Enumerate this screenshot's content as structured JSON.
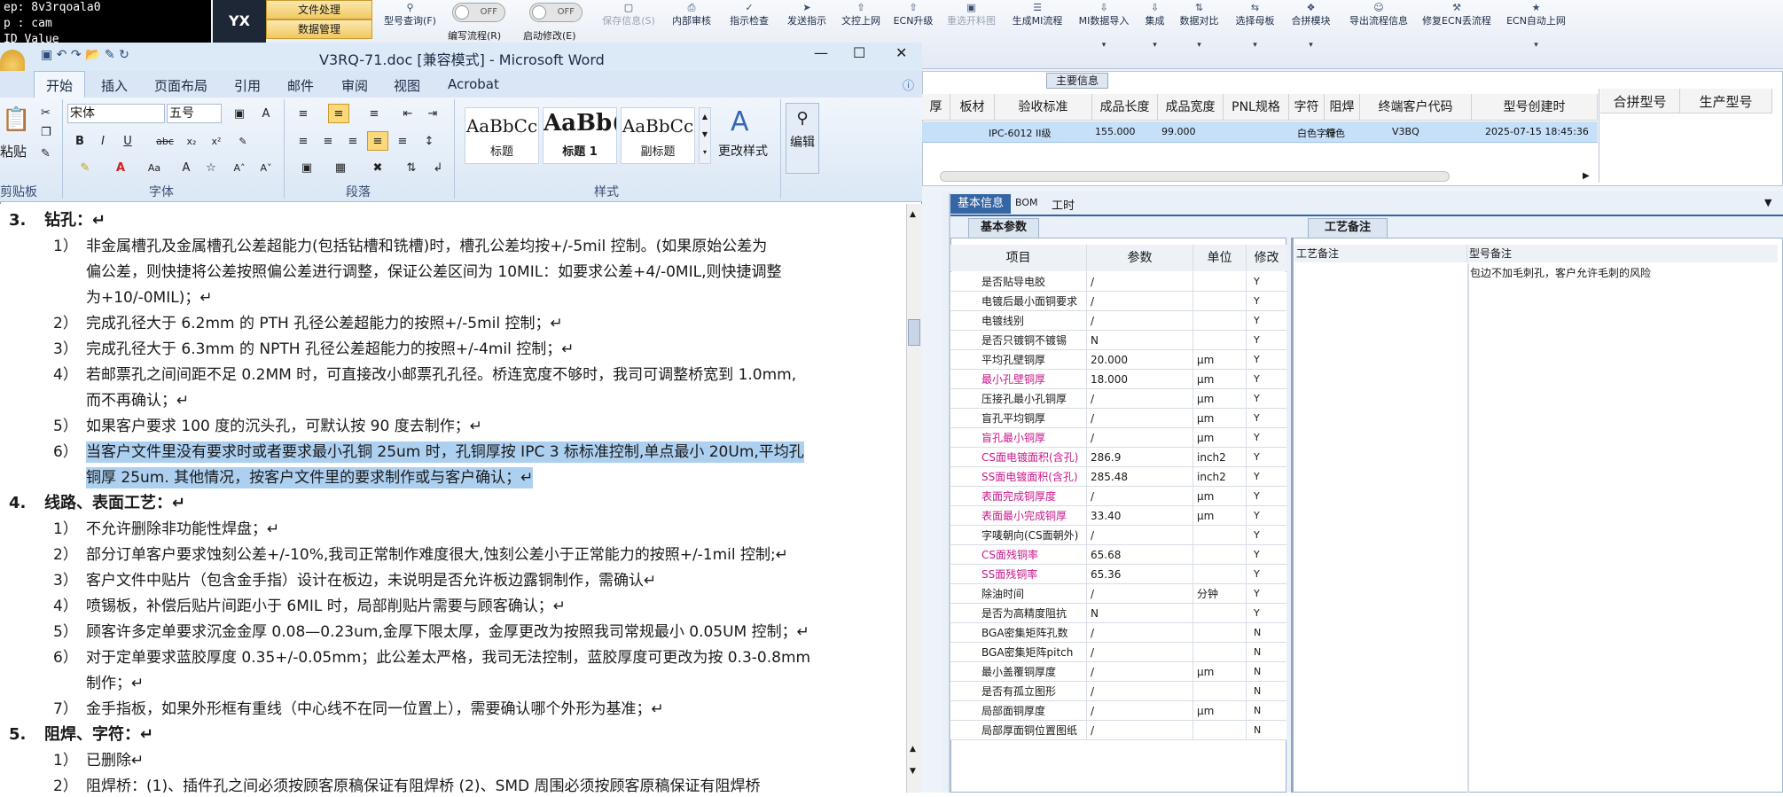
{
  "terminal": {
    "line1": "ep: 8v3rqoala0",
    "line2": "p : cam",
    "line3": "ID Value"
  },
  "logo": "YX",
  "app_menu": [
    "文件处理",
    "数据管理"
  ],
  "toggles": [
    {
      "label": "编写流程(R)",
      "state": "OFF"
    },
    {
      "label": "启动修改(E)",
      "state": "OFF"
    }
  ],
  "toolbar": {
    "type_query": "型号查询(F)",
    "buttons": [
      "保存信息(S)",
      "内部审核",
      "指示检查",
      "发送指示",
      "文控上网",
      "ECN升级",
      "重选开料图",
      "生成MI流程",
      "MI数据导入",
      "集成",
      "数据对比",
      "选择母板",
      "合拼模块",
      "导出流程信息",
      "修复ECN丢流程",
      "ECN自动上网"
    ]
  },
  "main_info_label": "主要信息",
  "info_table": {
    "headers": [
      "厚",
      "板材",
      "验收标准",
      "成品长度",
      "成品宽度",
      "PNL规格",
      "字符",
      "阻焊",
      "终端客户代码",
      "型号创建时"
    ],
    "row": [
      "",
      "",
      "IPC-6012 II级",
      "155.000",
      "99.000",
      "",
      "白色字符",
      "绿色",
      "V3BQ",
      "2025-07-15 18:45:36"
    ],
    "extra_headers": [
      "合拼型号",
      "生产型号"
    ]
  },
  "bottom_tabs": [
    "基本信息",
    "BOM",
    "工时"
  ],
  "basic_params_tab": "基本参数",
  "craft_notes_tab": "工艺备注",
  "params_headers": {
    "item": "项目",
    "param": "参数",
    "unit": "单位",
    "modify": "修改"
  },
  "params_rows": [
    {
      "item": "是否贴导电胶",
      "val": "/",
      "unit": "",
      "mod": "Y"
    },
    {
      "item": "电镀后最小面铜要求",
      "val": "/",
      "unit": "",
      "mod": "Y"
    },
    {
      "item": "电镀线别",
      "val": "/",
      "unit": "",
      "mod": "Y"
    },
    {
      "item": "是否只镀铜不镀锡",
      "val": "N",
      "unit": "",
      "mod": "Y"
    },
    {
      "item": "平均孔壁铜厚",
      "val": "20.000",
      "unit": "μm",
      "mod": "Y"
    },
    {
      "item": "最小孔壁铜厚",
      "val": "18.000",
      "unit": "μm",
      "mod": "Y"
    },
    {
      "item": "压接孔最小孔铜厚",
      "val": "/",
      "unit": "μm",
      "mod": "Y"
    },
    {
      "item": "盲孔平均铜厚",
      "val": "/",
      "unit": "μm",
      "mod": "Y"
    },
    {
      "item": "盲孔最小铜厚",
      "val": "/",
      "unit": "μm",
      "mod": "Y"
    },
    {
      "item": "CS面电镀面积(含孔)",
      "val": "286.9",
      "unit": "inch2",
      "mod": "Y"
    },
    {
      "item": "SS面电镀面积(含孔)",
      "val": "285.48",
      "unit": "inch2",
      "mod": "Y"
    },
    {
      "item": "表面完成铜厚度",
      "val": "/",
      "unit": "μm",
      "mod": "Y"
    },
    {
      "item": "表面最小完成铜厚",
      "val": "33.40",
      "unit": "μm",
      "mod": "Y"
    },
    {
      "item": "字唛朝向(CS面朝外)",
      "val": "/",
      "unit": "",
      "mod": "Y"
    },
    {
      "item": "CS面残铜率",
      "val": "65.68",
      "unit": "",
      "mod": "Y"
    },
    {
      "item": "SS面残铜率",
      "val": "65.36",
      "unit": "",
      "mod": "Y"
    },
    {
      "item": "除油时间",
      "val": "/",
      "unit": "分钟",
      "mod": "Y"
    },
    {
      "item": "是否为高精度阻抗",
      "val": "N",
      "unit": "",
      "mod": "Y"
    },
    {
      "item": "BGA密集矩阵孔数",
      "val": "/",
      "unit": "",
      "mod": "N"
    },
    {
      "item": "BGA密集矩阵pitch",
      "val": "/",
      "unit": "",
      "mod": "N"
    },
    {
      "item": "最小盖覆铜厚度",
      "val": "/",
      "unit": "μm",
      "mod": "N"
    },
    {
      "item": "是否有孤立图形",
      "val": "/",
      "unit": "",
      "mod": "N"
    },
    {
      "item": "局部面铜厚度",
      "val": "/",
      "unit": "μm",
      "mod": "N"
    },
    {
      "item": "局部厚面铜位置图纸",
      "val": "/",
      "unit": "",
      "mod": "N"
    }
  ],
  "craft_headers": {
    "craft": "工艺备注",
    "type": "型号备注"
  },
  "craft_note_text": "包边不加毛刺孔，客户允许毛刺的风险",
  "word": {
    "title": "V3RQ-71.doc [兼容模式] - Microsoft Word",
    "tabs": [
      "开始",
      "插入",
      "页面布局",
      "引用",
      "邮件",
      "审阅",
      "视图",
      "Acrobat"
    ],
    "font_name": "宋体",
    "font_size": "五号",
    "paste": "粘贴",
    "groups": [
      "剪贴板",
      "字体",
      "段落",
      "样式",
      "编辑"
    ],
    "styles": [
      {
        "sample": "AaBbCc",
        "name": "标题"
      },
      {
        "sample": "AaBb(",
        "name": "标题 1"
      },
      {
        "sample": "AaBbCc",
        "name": "副标题"
      }
    ],
    "change_style": "更改样式",
    "edit": "编辑"
  },
  "doc": [
    {
      "n": "3.",
      "t": "钻孔：↵",
      "h": 1
    },
    {
      "n": "1）",
      "t": "非金属槽孔及金属槽孔公差超能力(包括钻槽和铣槽)时，槽孔公差均按+/-5mil 控制。(如果原始公差为"
    },
    {
      "n": "",
      "t": "偏公差，则快捷将公差按照偏公差进行调整，保证公差区间为 10MIL：如要求公差+4/-0MIL,则快捷调整"
    },
    {
      "n": "",
      "t": "为+10/-0MIL)；↵"
    },
    {
      "n": "2）",
      "t": "完成孔径大于 6.2mm 的 PTH 孔径公差超能力的按照+/-5mil 控制；↵"
    },
    {
      "n": "3）",
      "t": "完成孔径大于 6.3mm 的 NPTH 孔径公差超能力的按照+/-4mil 控制；↵"
    },
    {
      "n": "4）",
      "t": "若邮票孔之间间距不足 0.2MM 时，可直接改小邮票孔孔径。桥连宽度不够时，我司可调整桥宽到 1.0mm,"
    },
    {
      "n": "",
      "t": "而不再确认；↵"
    },
    {
      "n": "5）",
      "t": "如果客户要求 100 度的沉头孔，可默认按 90 度去制作；↵"
    },
    {
      "n": "6）",
      "t": "当客户文件里没有要求时或者要求最小孔铜 25um 时，孔铜厚按 IPC 3 标标准控制,单点最小 20Um,平均孔",
      "sel": 1
    },
    {
      "n": "",
      "t": "铜厚 25um. 其他情况，按客户文件里的要求制作或与客户确认；↵",
      "sel": 1
    },
    {
      "n": "4.",
      "t": "线路、表面工艺：↵",
      "h": 1
    },
    {
      "n": "1）",
      "t": "不允许删除非功能性焊盘；↵"
    },
    {
      "n": "2）",
      "t": "部分订单客户要求蚀刻公差+/-10%,我司正常制作难度很大,蚀刻公差小于正常能力的按照+/-1mil 控制;↵"
    },
    {
      "n": "3）",
      "t": "客户文件中贴片（包含金手指）设计在板边，未说明是否允许板边露铜制作，需确认↵"
    },
    {
      "n": "4）",
      "t": "喷锡板，补偿后贴片间距小于 6MIL 时，局部削贴片需要与顾客确认；↵"
    },
    {
      "n": "5）",
      "t": "顾客许多定单要求沉金金厚 0.08—0.23um,金厚下限太厚，金厚更改为按照我司常规最小 0.05UM 控制；↵"
    },
    {
      "n": "6）",
      "t": "对于定单要求蓝胶厚度 0.35+/-0.05mm；此公差太严格，我司无法控制，蓝胶厚度可更改为按 0.3-0.8mm"
    },
    {
      "n": "",
      "t": "制作；↵"
    },
    {
      "n": "7）",
      "t": "金手指板，如果外形框有重线（中心线不在同一位置上），需要确认哪个外形为基准；↵"
    },
    {
      "n": "5.",
      "t": "阻焊、字符：↵",
      "h": 1
    },
    {
      "n": "1）",
      "t": "已删除↵"
    },
    {
      "n": "2）",
      "t": "阻焊桥：(1)、插件孔之间必须按顾客原稿保证有阻焊桥 (2)、SMD 周围必须按顾客原稿保证有阻焊桥"
    }
  ]
}
